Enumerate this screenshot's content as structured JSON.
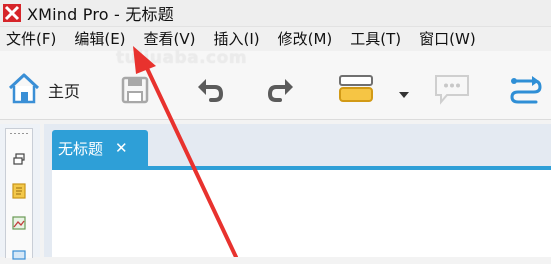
{
  "window": {
    "title": "XMind Pro - 无标题",
    "logo_icon": "xmind-logo-icon",
    "accent": "#d6252a"
  },
  "menu": {
    "items": [
      {
        "label": "文件(F)"
      },
      {
        "label": "编辑(E)"
      },
      {
        "label": "查看(V)"
      },
      {
        "label": "插入(I)"
      },
      {
        "label": "修改(M)"
      },
      {
        "label": "工具(T)"
      },
      {
        "label": "窗口(W)"
      }
    ]
  },
  "toolbar": {
    "home_label": "主页",
    "icons": [
      "home-icon",
      "save-icon",
      "undo-icon",
      "redo-icon",
      "topic-style-icon",
      "dropdown-arrow-icon",
      "comment-icon",
      "relationship-icon"
    ],
    "accent": "#3a8fd6"
  },
  "watermark": {
    "text": "tuliuaba.com"
  },
  "editor": {
    "tab_label": "无标题",
    "tab_close": "✕",
    "tab_color": "#2e9fd7"
  },
  "annotation": {
    "arrow_color": "#e8322e"
  }
}
